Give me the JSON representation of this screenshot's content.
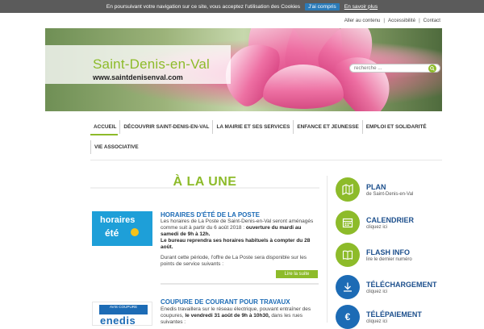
{
  "cookie": {
    "message": "En poursuivant votre navigation sur ce site, vous acceptez l'utilisation des Cookies",
    "ok_label": "J'ai compris",
    "more_label": "En savoir plus"
  },
  "top_links": [
    "Aller au contenu",
    "Accessibilité",
    "Contact"
  ],
  "header": {
    "site_name": "Saint-Denis-en-Val",
    "site_url": "www.saintdenisenval.com",
    "search_placeholder": "recherche ..."
  },
  "nav": {
    "items": [
      "ACCUEIL",
      "DÉCOUVRIR SAINT-DENIS-EN-VAL",
      "LA MAIRIE ET SES SERVICES",
      "ENFANCE ET JEUNESSE",
      "EMPLOI ET SOLIDARITÉ"
    ],
    "items_row2": [
      "VIE ASSOCIATIVE"
    ]
  },
  "main": {
    "section_title": "À LA UNE",
    "articles": [
      {
        "thumb_line1": "horaires",
        "thumb_line2": "été",
        "title": "HORAIRES D'ÉTÉ DE LA POSTE",
        "body_1": "Les horaires de La Poste de Saint-Denis-en-Val seront aménagés comme suit à partir du 6 août 2018 :",
        "body_bold_1": "ouverture du mardi au samedi de 9h à 12h.",
        "body_bold_2": "Le bureau reprendra ses horaires habituels à compter du 28 août.",
        "body_2": "Durant cette période, l'offre de La Poste sera disponible sur les points de service suivants :",
        "read_more": "Lire la suite"
      },
      {
        "thumb_badge": "AVIS COUPURE",
        "thumb_logo": "enedis",
        "title": "COUPURE DE COURANT POUR TRAVAUX",
        "body_1": "Enedis travaillera sur le réseau électrique, pouvant entraîner des coupures,",
        "body_bold_1": "le vendredi 31 août de 9h à 10h30,",
        "body_2": "dans les rues suivantes :"
      }
    ]
  },
  "quick_links": [
    {
      "title": "PLAN",
      "sub": "de Saint-Denis-en-Val",
      "icon": "map-icon",
      "color": "#8dbb2a"
    },
    {
      "title": "CALENDRIER",
      "sub": "cliquez ici",
      "icon": "calendar-icon",
      "color": "#8dbb2a"
    },
    {
      "title": "FLASH INFO",
      "sub": "lire le dernier numéro",
      "icon": "book-icon",
      "color": "#8dbb2a"
    },
    {
      "title": "TÉLÉCHARGEMENT",
      "sub": "cliquez ici",
      "icon": "download-icon",
      "color": "#1c6bb5"
    },
    {
      "title": "TÉLÉPAIEMENT",
      "sub": "cliquez ici",
      "icon": "euro-icon",
      "color": "#1c6bb5"
    }
  ],
  "colors": {
    "accent_green": "#8dbb2a",
    "accent_blue": "#1c6bb5"
  }
}
